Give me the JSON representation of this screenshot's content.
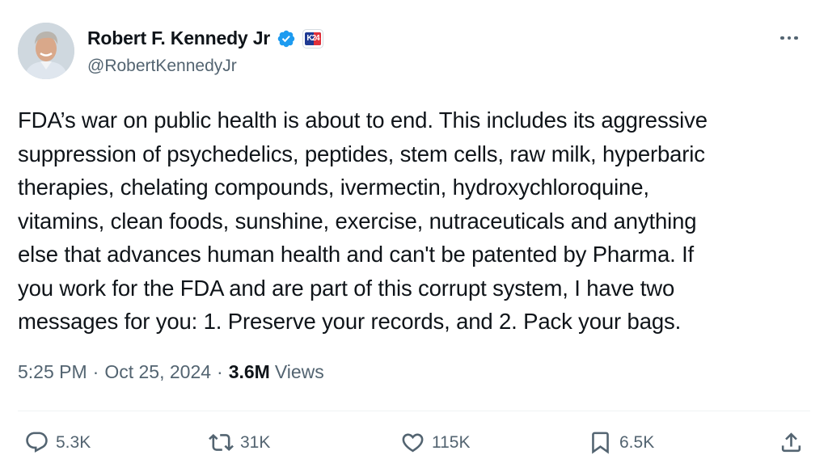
{
  "author": {
    "name": "Robert F. Kennedy Jr",
    "handle": "@RobertKennedyJr",
    "affiliation_badge": "K24"
  },
  "tweet": {
    "text": "FDA’s war on public health is about to end. This includes its aggressive\nsuppression of psychedelics, peptides, stem cells, raw milk, hyperbaric\ntherapies, chelating compounds, ivermectin, hydroxychloroquine,\nvitamins, clean foods, sunshine, exercise, nutraceuticals and anything\nelse that advances human health and can't be patented by Pharma. If\nyou work for the FDA and are part of this corrupt system, I have two\nmessages for you: 1. Preserve your records, and 2. Pack your bags.",
    "time": "5:25 PM",
    "date": "Oct 25, 2024",
    "separator": "·",
    "views_count": "3.6M",
    "views_label": "Views"
  },
  "actions": {
    "replies": "5.3K",
    "reposts": "31K",
    "likes": "115K",
    "bookmarks": "6.5K"
  },
  "icons": {
    "verified": "verified-badge-icon",
    "more": "more-icon",
    "reply": "reply-icon",
    "repost": "repost-icon",
    "like": "heart-icon",
    "bookmark": "bookmark-icon",
    "share": "share-icon"
  },
  "colors": {
    "verified_blue": "#1d9bf0",
    "secondary_text": "#536471",
    "primary_text": "#0f1419"
  }
}
